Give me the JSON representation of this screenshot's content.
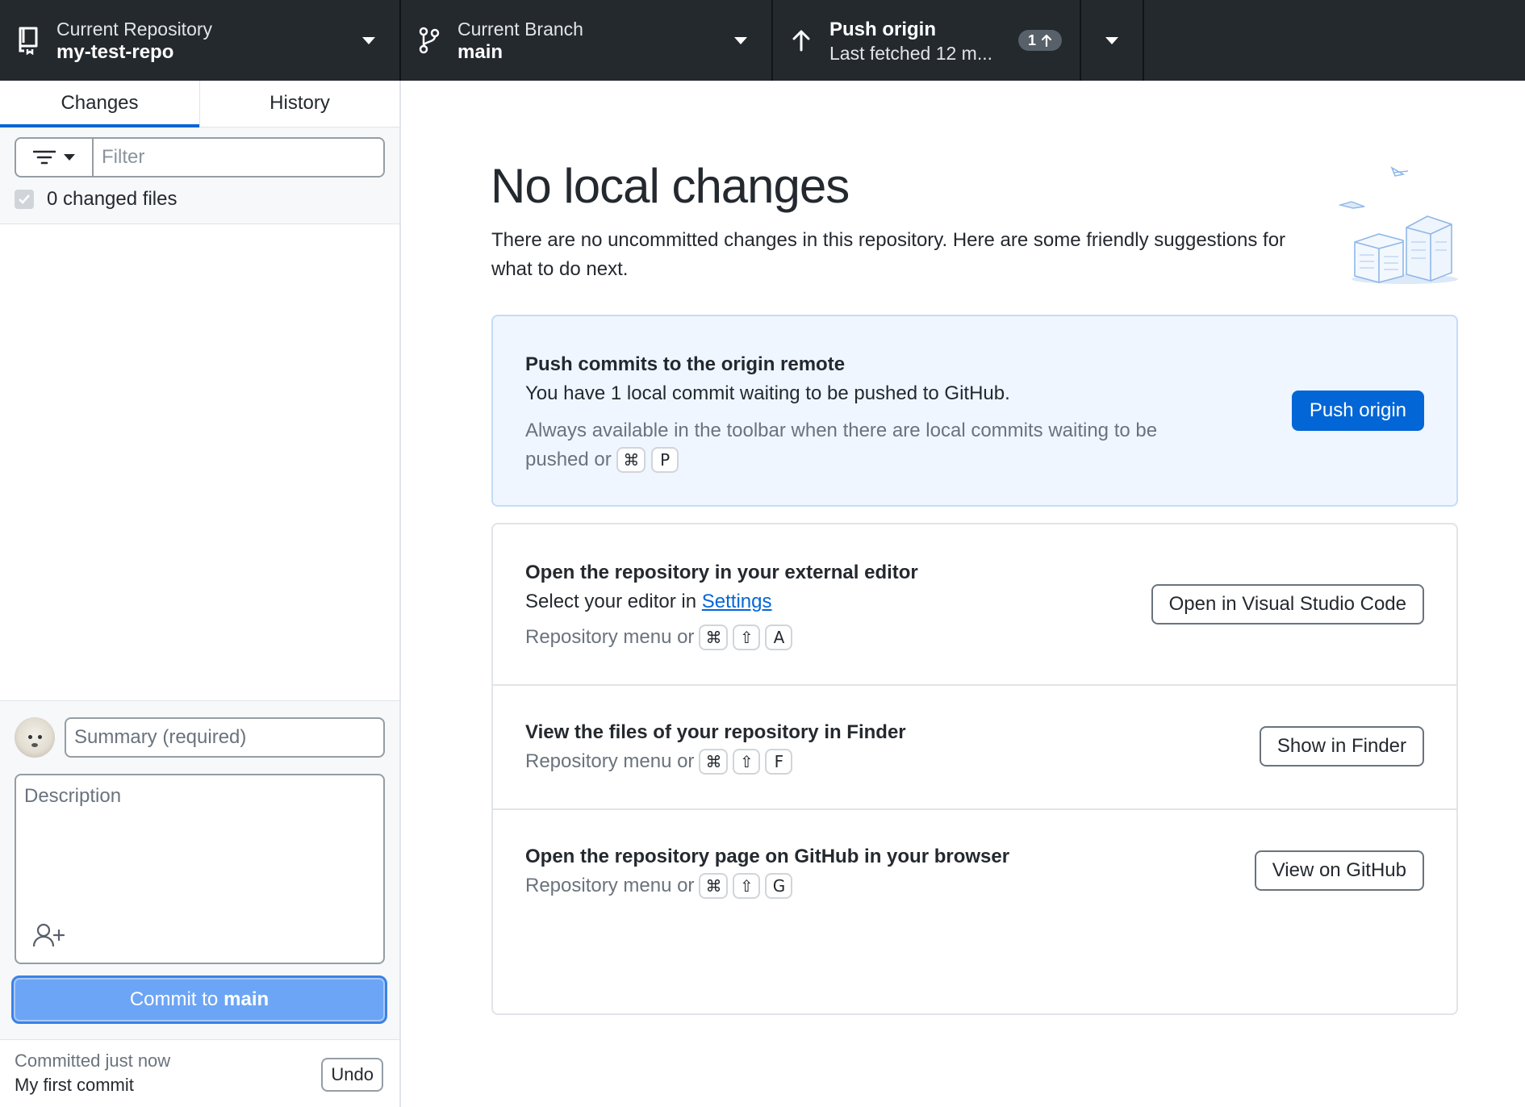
{
  "toolbar": {
    "repo": {
      "label": "Current Repository",
      "value": "my-test-repo",
      "icon": "repo-icon"
    },
    "branch": {
      "label": "Current Branch",
      "value": "main",
      "icon": "git-branch-icon"
    },
    "push": {
      "label": "Push origin",
      "value": "Last fetched 12 m...",
      "badge_count": "1",
      "icon": "arrow-up-icon"
    }
  },
  "sidebar": {
    "tabs": [
      {
        "label": "Changes",
        "active": true
      },
      {
        "label": "History",
        "active": false
      }
    ],
    "filter": {
      "placeholder": "Filter"
    },
    "changed_files_label": "0 changed files",
    "commit": {
      "summary_placeholder": "Summary (required)",
      "description_placeholder": "Description",
      "button_prefix": "Commit to",
      "button_branch": "main"
    },
    "last_commit": {
      "time": "Committed just now",
      "message": "My first commit",
      "undo_label": "Undo"
    }
  },
  "main": {
    "heading": "No local changes",
    "subtext": "There are no uncommitted changes in this repository. Here are some friendly suggestions for what to do next.",
    "push_card": {
      "title": "Push commits to the origin remote",
      "desc": "You have 1 local commit waiting to be pushed to GitHub.",
      "hint": "Always available in the toolbar when there are local commits waiting to be pushed or",
      "keys": [
        "⌘",
        "P"
      ],
      "button": "Push origin"
    },
    "suggestions": [
      {
        "title": "Open the repository in your external editor",
        "desc_prefix": "Select your editor in",
        "desc_link": "Settings",
        "hint": "Repository menu or",
        "keys": [
          "⌘",
          "⇧",
          "A"
        ],
        "button": "Open in Visual Studio Code"
      },
      {
        "title": "View the files of your repository in Finder",
        "hint": "Repository menu or",
        "keys": [
          "⌘",
          "⇧",
          "F"
        ],
        "button": "Show in Finder"
      },
      {
        "title": "Open the repository page on GitHub in your browser",
        "hint": "Repository menu or",
        "keys": [
          "⌘",
          "⇧",
          "G"
        ],
        "button": "View on GitHub"
      }
    ]
  },
  "colors": {
    "toolbar_bg": "#24292e",
    "accent": "#0366d6",
    "commit_button": "#6ca5f5",
    "push_card_bg": "#eff6ff"
  }
}
